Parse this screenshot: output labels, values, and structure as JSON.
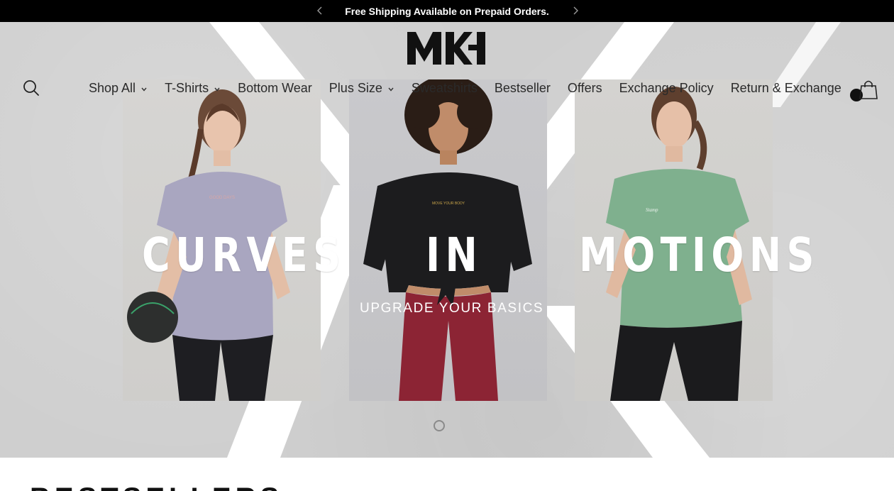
{
  "announcement": {
    "message": "Free Shipping Available on Prepaid Orders.",
    "prev_icon": "chevron-left-icon",
    "next_icon": "chevron-right-icon"
  },
  "header": {
    "logo_text": "MK",
    "search_icon": "search-icon",
    "cart_icon": "shopping-bag-icon",
    "nav": [
      {
        "label": "Shop All",
        "has_dropdown": true
      },
      {
        "label": "T-Shirts",
        "has_dropdown": true
      },
      {
        "label": "Bottom Wear",
        "has_dropdown": false
      },
      {
        "label": "Plus Size",
        "has_dropdown": true
      },
      {
        "label": "Sweatshirts",
        "has_dropdown": false
      },
      {
        "label": "Bestseller",
        "has_dropdown": false
      },
      {
        "label": "Offers",
        "has_dropdown": false
      },
      {
        "label": "Exchange Policy",
        "has_dropdown": false
      },
      {
        "label": "Return & Exchange",
        "has_dropdown": false
      }
    ]
  },
  "hero": {
    "words": [
      "CURVES",
      "IN",
      "MOTIONS"
    ],
    "subtitle": "UPGRADE YOUR BASICS",
    "slide_indicator_icon": "slide-dot-icon"
  },
  "section": {
    "title": "BESTSELLERS"
  },
  "colors": {
    "announcement_bg": "#000000",
    "hero_bg": "#cfcfcf",
    "nav_text": "#2a2a2a",
    "tee_lavender": "#a9a6c0",
    "tee_black": "#1c1c1e",
    "tee_green": "#7fb08e",
    "pants_maroon": "#8c2434"
  }
}
